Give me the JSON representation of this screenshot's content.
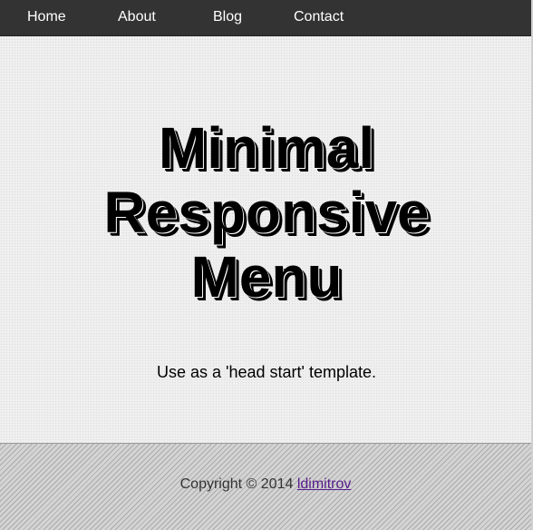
{
  "nav": {
    "items": [
      {
        "label": "Home"
      },
      {
        "label": "About"
      },
      {
        "label": "Blog"
      },
      {
        "label": "Contact"
      }
    ]
  },
  "hero": {
    "title_lines": [
      "Minimal",
      "Responsive",
      "Menu"
    ],
    "subtitle": "Use as a 'head start' template."
  },
  "footer": {
    "copyright": "Copyright © 2014 ",
    "author_link": "ldimitrov"
  },
  "colors": {
    "navbar_bg": "#333333",
    "nav_text": "#ffffff",
    "page_bg": "#efefef",
    "link_visited": "#551a8b"
  }
}
